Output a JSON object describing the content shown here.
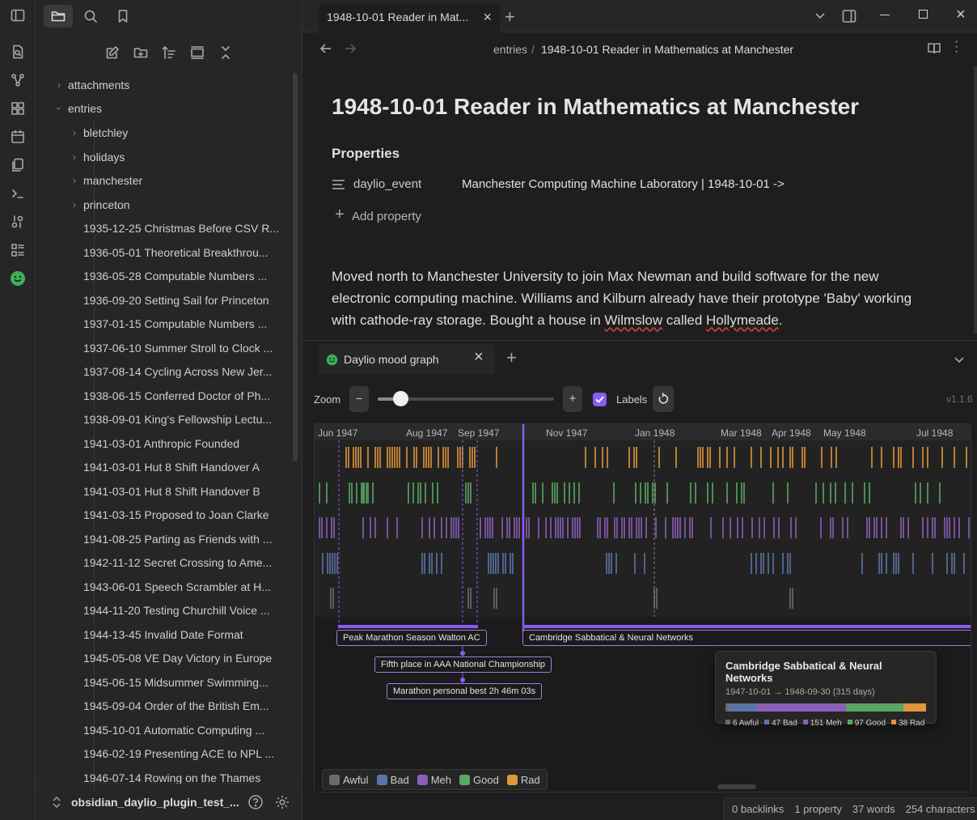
{
  "colors": {
    "accent": "#8a5cf5",
    "awful": "#6b6b6b",
    "bad": "#5b74a8",
    "meh": "#8b5fb8",
    "good": "#5aa663",
    "rad": "#e0963a"
  },
  "tabs": [
    {
      "label": "1948-10-01 Reader in Mat..."
    }
  ],
  "sidebar": {
    "folders": [
      {
        "label": "attachments",
        "state": "collapsed"
      },
      {
        "label": "entries",
        "state": "expanded"
      }
    ],
    "subfolders": [
      "bletchley",
      "holidays",
      "manchester",
      "princeton"
    ],
    "files": [
      "1935-12-25 Christmas Before CSV R...",
      "1936-05-01 Theoretical Breakthrou...",
      "1936-05-28 Computable Numbers ...",
      "1936-09-20 Setting Sail for Princeton",
      "1937-01-15 Computable Numbers ...",
      "1937-06-10 Summer Stroll to Clock ...",
      "1937-08-14 Cycling Across New Jer...",
      "1938-06-15 Conferred Doctor of Ph...",
      "1938-09-01 King's Fellowship Lectu...",
      "1941-03-01 Anthropic Founded",
      "1941-03-01 Hut 8 Shift Handover A",
      "1941-03-01 Hut 8 Shift Handover B",
      "1941-03-15 Proposed to Joan Clarke",
      "1941-08-25 Parting as Friends with ...",
      "1942-11-12 Secret Crossing to Ame...",
      "1943-06-01 Speech Scrambler at H...",
      "1944-11-20 Testing Churchill Voice ...",
      "1944-13-45 Invalid Date Format",
      "1945-05-08 VE Day Victory in Europe",
      "1945-06-15 Midsummer Swimming...",
      "1945-09-04 Order of the British Em...",
      "1945-10-01 Automatic Computing ...",
      "1946-02-19 Presenting ACE to NPL ...",
      "1946-07-14 Rowing on the Thames"
    ],
    "vault_name": "obsidian_daylio_plugin_test_..."
  },
  "breadcrumb": {
    "folder": "entries",
    "separator": "/",
    "current": "1948-10-01 Reader in Mathematics at Manchester"
  },
  "note": {
    "title": "1948-10-01 Reader in Mathematics at Manchester",
    "properties_heading": "Properties",
    "property": {
      "key": "daylio_event",
      "value": "Manchester Computing Machine Laboratory | 1948-10-01 ->"
    },
    "add_property": "Add property",
    "body_lines": [
      "Moved north to Manchester University to join Max Newman and build software for the new",
      "electronic computing machine. Williams and Kilburn already have their prototype 'Baby' working",
      "with cathode-ray storage. Bought a house in "
    ],
    "body_word_wilmslow": "Wilmslow",
    "body_mid": " called ",
    "body_word_hollymeade": "Hollymeade",
    "body_end": "."
  },
  "panel": {
    "tab_label": "Daylio mood graph",
    "zoom_label": "Zoom",
    "zoom_minus": "−",
    "zoom_plus": "+",
    "zoom_value": 0.13,
    "labels_label": "Labels",
    "labels_checked": true,
    "version": "v1.1.6",
    "axis_months": [
      "Jun 1947",
      "Aug 1947",
      "Sep 1947",
      "Nov 1947",
      "Jan 1948",
      "Mar 1948",
      "Apr 1948",
      "May 1948",
      "Jul 1948"
    ],
    "events": [
      "Peak Marathon Season Walton AC",
      "Fifth place in AAA National Championship",
      "Marathon personal best 2h 46m 03s",
      "Cambridge Sabbatical & Neural Networks"
    ],
    "legend": [
      "Awful",
      "Bad",
      "Meh",
      "Good",
      "Rad"
    ],
    "tooltip": {
      "title": "Cambridge Sabbatical & Neural Networks",
      "range": "1947-10-01 → 1948-09-30 (315 days)",
      "counts": [
        {
          "label": "6 Awful",
          "value": 6
        },
        {
          "label": "47 Bad",
          "value": 47
        },
        {
          "label": "151 Meh",
          "value": 151
        },
        {
          "label": "97 Good",
          "value": 97
        },
        {
          "label": "38 Rad",
          "value": 38
        }
      ]
    }
  },
  "status": {
    "backlinks": "0 backlinks",
    "properties": "1 property",
    "words": "37 words",
    "characters": "254 characters"
  }
}
